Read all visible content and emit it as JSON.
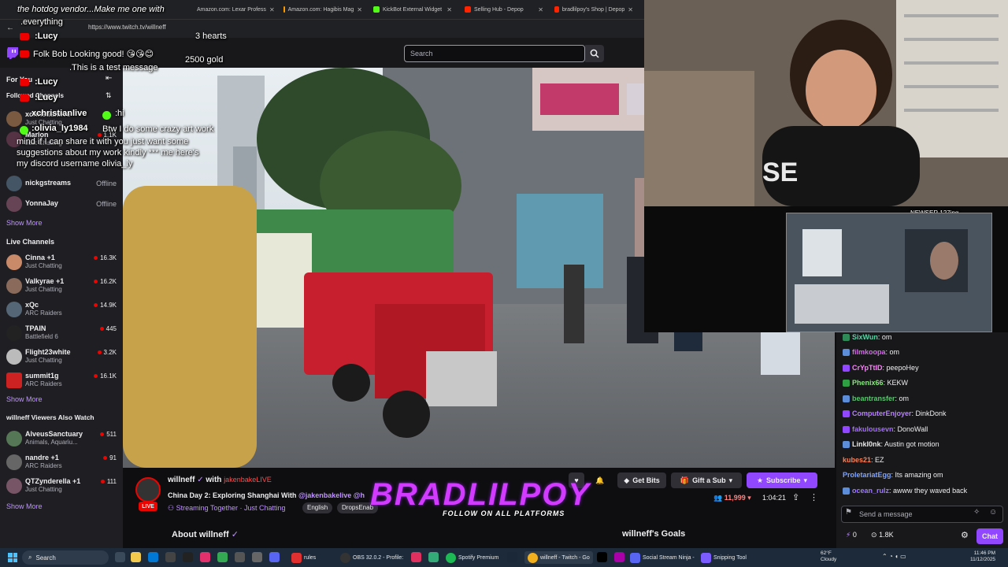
{
  "browser": {
    "tabs": [
      {
        "label": "Amazon.com: Lexar Profess",
        "color": "#ff9900"
      },
      {
        "label": "Amazon.com: Hagibis Mag",
        "color": "#ff9900"
      },
      {
        "label": "KickBot External Widget",
        "color": "#53fc18"
      },
      {
        "label": "Selling Hub - Depop",
        "color": "#ff2300"
      },
      {
        "label": "bradlilpoy's Shop | Depop",
        "color": "#ff2300"
      }
    ],
    "url": "https://www.twitch.tv/willneff"
  },
  "search": {
    "placeholder": "Search"
  },
  "sidebar": {
    "for_you": "For You",
    "followed_title": "Followed Channels",
    "followed": [
      {
        "name": "xchristianlive",
        "sub": "Just Chatting",
        "color": "#7a5a40"
      },
      {
        "name": "Marlon",
        "sub": "Just Chatting",
        "viewers": "1.1K",
        "color": "#553344"
      },
      {
        "name": "nickgstreams",
        "status": "Offline",
        "color": "#445566"
      },
      {
        "name": "YonnaJay",
        "status": "Offline",
        "color": "#664455"
      }
    ],
    "show_more_1": "Show More",
    "live_title": "Live Channels",
    "live": [
      {
        "name": "Cinna +1",
        "sub": "Just Chatting",
        "viewers": "16.3K",
        "color": "#c98a6a"
      },
      {
        "name": "Valkyrae +1",
        "sub": "Just Chatting",
        "viewers": "16.2K",
        "color": "#8a6a5a"
      },
      {
        "name": "xQc",
        "sub": "ARC Raiders",
        "viewers": "14.9K",
        "color": "#556677"
      },
      {
        "name": "TPAIN",
        "sub": "Battlefield 6",
        "viewers": "445",
        "color": "#222222"
      },
      {
        "name": "Flight23white",
        "sub": "Just Chatting",
        "viewers": "3.2K",
        "color": "#bbbbbb"
      },
      {
        "name": "summit1g",
        "sub": "ARC Raiders",
        "viewers": "16.1K",
        "color": "#cc2222"
      }
    ],
    "show_more_2": "Show More",
    "also_title": "willneff Viewers Also Watch",
    "also": [
      {
        "name": "AlveusSanctuary",
        "sub": "Animals, Aquariu...",
        "viewers": "511",
        "color": "#557755"
      },
      {
        "name": "nandre +1",
        "sub": "ARC Raiders",
        "viewers": "91",
        "color": "#666666"
      },
      {
        "name": "QTZynderella +1",
        "sub": "Just Chatting",
        "viewers": "111",
        "color": "#775566"
      }
    ],
    "show_more_3": "Show More"
  },
  "overlay": {
    "line1": "the hotdog vendor...Make me one with",
    "line2": ".everything",
    "lucy1": ":Lucy",
    "bob": "Bob Looking good!",
    "bob_prefix": "Folk",
    "test": ".This is a test message",
    "lucy2": ":Lucy",
    "lucy3": ":Lucy",
    "hearts": "3 hearts",
    "gold": "2500 gold",
    "xchristian_hi": ":hi",
    "olivia_name": ":olivia_ly1984",
    "olivia_msg1": "Btw I do some crazy art work",
    "olivia_msg2": "mind if I can share it with you just want some",
    "olivia_msg3": "suggestions about my work kindly *** me here's",
    "olivia_msg4": "my discord username olivia_ly",
    "banner_big": "BRADLILPOY",
    "banner_small": "FOLLOW ON ALL PLATFORMS",
    "newser": "NEWSER 127ing"
  },
  "stream": {
    "channel": "willneff",
    "with": "with",
    "collab": "jakenbakeLIVE",
    "title": "China Day 2: Exploring Shanghai With",
    "title_mention": "@jakenbakelive @h",
    "streaming_together": "Streaming Together · Just Chatting",
    "tag1": "English",
    "tag2": "DropsEnab",
    "live_badge": "LIVE",
    "viewers": "11,999",
    "uptime": "1:04:21",
    "get_bits": "Get Bits",
    "gift_sub": "Gift a Sub",
    "subscribe": "Subscribe",
    "about": "About willneff",
    "goals": "willneff's Goals"
  },
  "chat": {
    "messages": [
      {
        "user": "SixWun",
        "text": "om",
        "color": "#5bd3a5",
        "badge": "#2e8b57"
      },
      {
        "user": "filmkoopa",
        "text": "om",
        "color": "#d36be8",
        "badge": "#5b8dd9"
      },
      {
        "user": "CrYpTtID",
        "text": "peepoHey",
        "color": "#ff80ff",
        "badge": "#9147ff"
      },
      {
        "user": "Phenix66",
        "text": "KEKW",
        "color": "#86e87b",
        "badge": "#2ea043"
      },
      {
        "user": "beantransfer",
        "text": "om",
        "color": "#58c46e",
        "badge": "#5b8dd9"
      },
      {
        "user": "ComputerEnjoyer",
        "text": "DinkDonk",
        "color": "#b780ff",
        "badge": "#9147ff"
      },
      {
        "user": "fakulousevn",
        "text": "DonoWall",
        "color": "#a46cff",
        "badge": "#9147ff"
      },
      {
        "user": "LinkI0nk",
        "text": "Austin got motion",
        "color": "#e8e8e8",
        "badge": "#5b8dd9"
      },
      {
        "user": "kubes21",
        "text": "EZ",
        "color": "#ff7f50",
        "badge": ""
      },
      {
        "user": "ProletariatEgg",
        "text": "Its amazing om",
        "color": "#7fa3ff",
        "badge": ""
      },
      {
        "user": "ocean_rulz",
        "text": "awww they waved back",
        "color": "#9d7aff",
        "badge": "#5b8dd9"
      }
    ],
    "input_placeholder": "Send a message",
    "points": "0",
    "points2": "1.8K",
    "chat_button": "Chat"
  },
  "taskbar": {
    "search": "Search",
    "apps": [
      {
        "label": "rules",
        "color": "#e03030"
      },
      {
        "label": "OBS 32.0.2 - Profile:",
        "color": "#333333"
      },
      {
        "label": "Spotify Premium",
        "color": "#1db954"
      },
      {
        "label": "willneff - Twitch - Go",
        "color": "#f2b01e"
      },
      {
        "label": "Social Stream Ninja -",
        "color": "#5865f2"
      },
      {
        "label": "Snipping Tool",
        "color": "#7a5cff"
      }
    ],
    "weather_temp": "62°F",
    "weather_desc": "Cloudy",
    "time": "11:46 PM",
    "date": "11/12/2025"
  }
}
